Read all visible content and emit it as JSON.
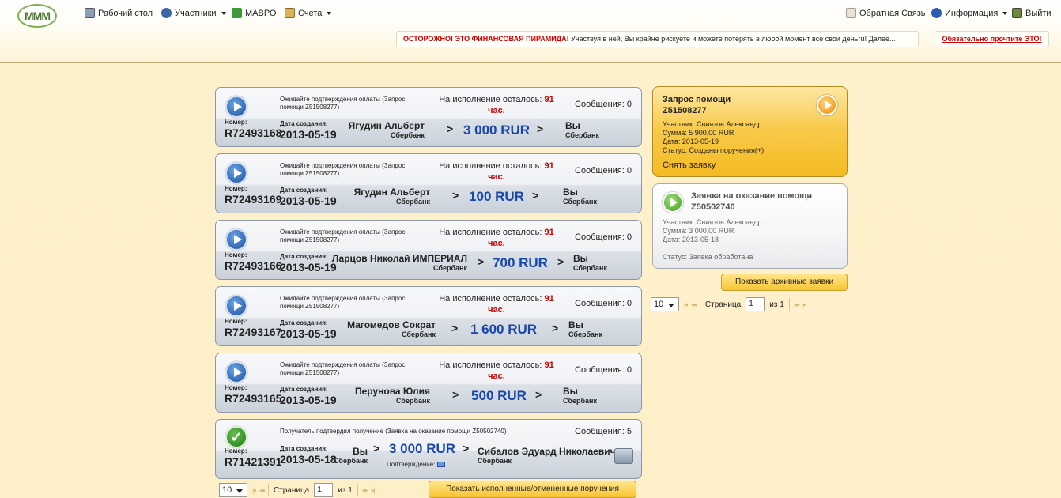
{
  "header": {
    "logo_text": "МММ",
    "nav": {
      "desktop": "Рабочий стол",
      "participants": "Участники",
      "mavro": "МАВРО",
      "accounts": "Счета",
      "feedback": "Обратная Связь",
      "info": "Информация",
      "logout": "Выйти"
    },
    "warning_red": "ОСТОРОЖНО! ЭТО ФИНАНСОВАЯ ПИРАМИДА!",
    "warning_text": "Участвуя в ней, Вы крайне рискуете и можете потерять в любой момент все свои деньги! Далее...",
    "must_read": "Обязательно прочтите ЭТО!"
  },
  "labels": {
    "number": "Номер:",
    "created": "Дата создания:",
    "remaining": "На исполнение осталось:",
    "hours_suffix": "час.",
    "messages": "Сообщения:",
    "confirmation": "Подтверждение:",
    "arrow": ">",
    "page": "Страница",
    "of": "из"
  },
  "orders": [
    {
      "status": "Ожидайте подтверждения оплаты (Запрос помощи Z51508277)",
      "hours": "91",
      "messages": "0",
      "number": "R72493168",
      "date": "2013-05-19",
      "from_name": "Ягудин Альберт",
      "from_bank": "Сбербанк",
      "amount": "3 000 RUR",
      "to_name": "Вы",
      "to_bank": "Сбербанк"
    },
    {
      "status": "Ожидайте подтверждения оплаты (Запрос помощи Z51508277)",
      "hours": "91",
      "messages": "0",
      "number": "R72493169",
      "date": "2013-05-19",
      "from_name": "Ягудин Альберт",
      "from_bank": "Сбербанк",
      "amount": "100 RUR",
      "to_name": "Вы",
      "to_bank": "Сбербанк"
    },
    {
      "status": "Ожидайте подтверждения оплаты (Запрос помощи Z51508277)",
      "hours": "91",
      "messages": "0",
      "number": "R72493166",
      "date": "2013-05-19",
      "from_name": "Ларцов Николай ИМПЕРИАЛ",
      "from_bank": "Сбербанк",
      "amount": "700 RUR",
      "to_name": "Вы",
      "to_bank": "Сбербанк"
    },
    {
      "status": "Ожидайте подтверждения оплаты (Запрос помощи Z51508277)",
      "hours": "91",
      "messages": "0",
      "number": "R72493167",
      "date": "2013-05-19",
      "from_name": "Магомедов Сократ",
      "from_bank": "Сбербанк",
      "amount": "1 600 RUR",
      "to_name": "Вы",
      "to_bank": "Сбербанк"
    },
    {
      "status": "Ожидайте подтверждения оплаты (Запрос помощи Z51508277)",
      "hours": "91",
      "messages": "0",
      "number": "R72493165",
      "date": "2013-05-19",
      "from_name": "Перунова Юлия",
      "from_bank": "Сбербанк",
      "amount": "500 RUR",
      "to_name": "Вы",
      "to_bank": "Сбербанк"
    }
  ],
  "completed_order": {
    "status": "Получатель подтвердил получение (Заявка на оказание помощи Z50502740)",
    "messages": "5",
    "number": "R71421391",
    "date": "2013-05-18",
    "from_name": "Вы",
    "from_bank": "Сбербанк",
    "amount": "3 000 RUR",
    "to_name": "Сибалов Эдуард Николаевич",
    "to_bank": "Сбербанк"
  },
  "left_pager": {
    "page_size": "10",
    "page": "1",
    "total": "1"
  },
  "show_completed_button": "Показать исполненные/отмененные поручения",
  "help_request": {
    "title": "Запрос помощи",
    "id": "Z51508277",
    "participant": "Участник: Свиязов Александр",
    "sum": "Сумма: 5 900,00 RUR",
    "date": "Дата: 2013-05-19",
    "status": "Статус: Созданы поручения(+)",
    "cancel": "Снять заявку"
  },
  "help_offer": {
    "title": "Заявка на оказание помощи",
    "id": "Z50502740",
    "participant": "Участник: Свиязов Александр",
    "sum": "Сумма: 3 000,00 RUR",
    "date": "Дата: 2013-05-18",
    "status": "Статус: Заявка обработана"
  },
  "show_archive_button": "Показать архивные заявки",
  "right_pager": {
    "page_size": "10",
    "page": "1",
    "total": "1"
  },
  "colors": {
    "amount": "#1747a8",
    "hours": "#cc0000",
    "warning": "#d40000",
    "gold": "#f8c531"
  }
}
